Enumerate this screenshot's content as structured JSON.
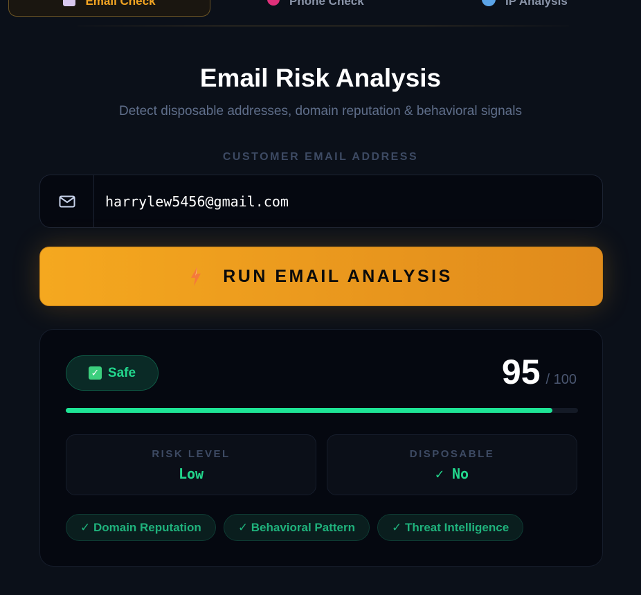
{
  "tabs": [
    {
      "label": "Email Check",
      "icon": "email-icon",
      "active": true
    },
    {
      "label": "Phone Check",
      "icon": "phone-icon",
      "active": false
    },
    {
      "label": "IP Analysis",
      "icon": "globe-icon",
      "active": false
    }
  ],
  "header": {
    "title": "Email Risk Analysis",
    "subtitle": "Detect disposable addresses, domain reputation & behavioral signals"
  },
  "form": {
    "field_label": "CUSTOMER EMAIL ADDRESS",
    "email_value": "harrylew5456@gmail.com",
    "run_button_label": "RUN EMAIL ANALYSIS"
  },
  "result": {
    "status": "Safe",
    "score": "95",
    "score_max": "/ 100",
    "score_fraction": 0.95,
    "metrics": [
      {
        "label": "RISK LEVEL",
        "value": "Low"
      },
      {
        "label": "DISPOSABLE",
        "value": "✓ No"
      }
    ],
    "tags": [
      "✓ Domain Reputation",
      "✓ Behavioral Pattern",
      "✓ Threat Intelligence"
    ]
  },
  "colors": {
    "accent": "#f5a623",
    "success": "#22d68c",
    "background": "#0b1019"
  }
}
